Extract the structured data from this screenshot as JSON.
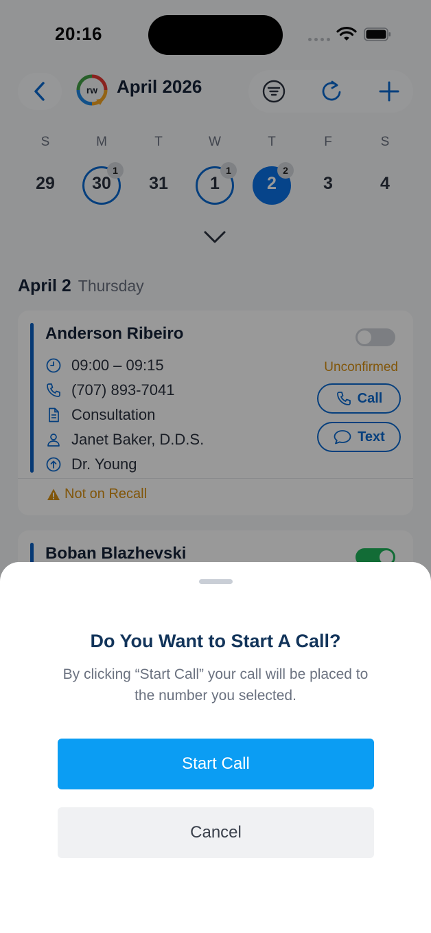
{
  "status_bar": {
    "time": "20:16"
  },
  "header": {
    "title": "April 2026",
    "logo_text": "rw"
  },
  "week": {
    "days_of_week": [
      "S",
      "M",
      "T",
      "W",
      "T",
      "F",
      "S"
    ],
    "dates": [
      {
        "num": "29",
        "badge": ""
      },
      {
        "num": "30",
        "badge": "1"
      },
      {
        "num": "31",
        "badge": ""
      },
      {
        "num": "1",
        "badge": "1"
      },
      {
        "num": "2",
        "badge": "2"
      },
      {
        "num": "3",
        "badge": ""
      },
      {
        "num": "4",
        "badge": ""
      }
    ]
  },
  "list": {
    "date_label": "April 2",
    "weekday_label": "Thursday",
    "appointments": [
      {
        "name": "Anderson Ribeiro",
        "time": "09:00 – 09:15",
        "phone": "(707) 893-7041",
        "type": "Consultation",
        "provider": "Janet Baker, D.D.S.",
        "doctor": "Dr. Young",
        "status": "Unconfirmed",
        "call_label": "Call",
        "text_label": "Text",
        "warning": "Not on Recall"
      },
      {
        "name": "Boban Blazhevski"
      }
    ]
  },
  "dialog": {
    "title": "Do You Want to Start A Call?",
    "message": "By clicking “Start Call” your call will be placed to the number you selected.",
    "start_label": "Start Call",
    "cancel_label": "Cancel"
  },
  "colors": {
    "accent": "#0a6ad1",
    "primary_button": "#0b9df3",
    "warning": "#d88f12",
    "toggle_on": "#1fb55b"
  }
}
